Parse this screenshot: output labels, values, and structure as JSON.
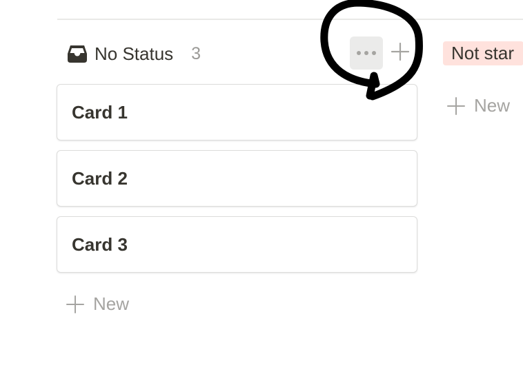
{
  "board": {
    "columns": [
      {
        "title": "No Status",
        "count": "3",
        "icon": "inbox-icon",
        "cards": [
          {
            "title": "Card 1"
          },
          {
            "title": "Card 2"
          },
          {
            "title": "Card 3"
          }
        ],
        "new_label": "New"
      },
      {
        "title": "Not star",
        "tag_color": "#ffe2dd",
        "new_label": "New"
      }
    ]
  },
  "icons": {
    "more": "more-horizontal-icon",
    "add": "plus-icon"
  },
  "annotation": {
    "type": "hand-drawn circle",
    "color": "#000000"
  }
}
